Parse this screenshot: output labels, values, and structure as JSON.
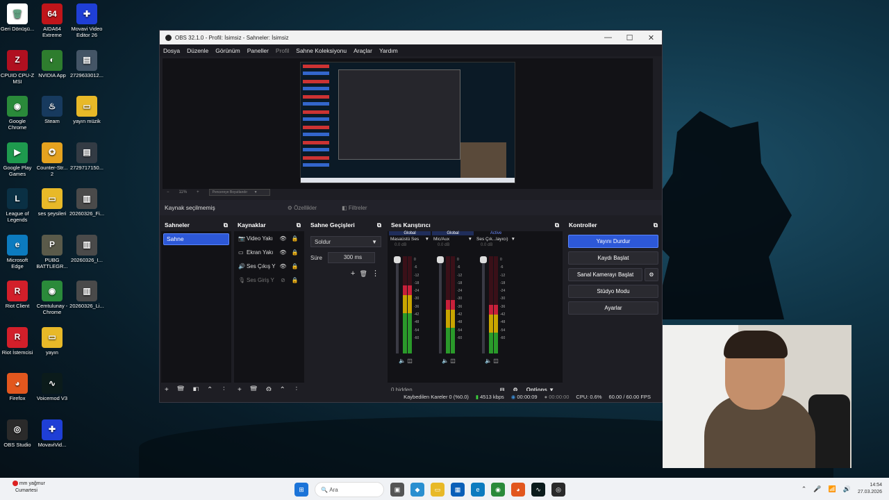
{
  "desktop_icons": [
    {
      "label": "Geri Dönüşü...",
      "color": "#ffffff",
      "glyph": "🗑",
      "x": 0,
      "y": 0
    },
    {
      "label": "AIDA64 Extreme",
      "color": "#c0151a",
      "glyph": "64",
      "x": 1,
      "y": 0
    },
    {
      "label": "Movavi Video Editor 26",
      "color": "#1f3fd6",
      "glyph": "✚",
      "x": 2,
      "y": 0
    },
    {
      "label": "CPUID CPU-Z MSI",
      "color": "#b01020",
      "glyph": "Z",
      "x": 0,
      "y": 1
    },
    {
      "label": "NVIDIA App",
      "color": "#2e7d2e",
      "glyph": "◐",
      "x": 1,
      "y": 1
    },
    {
      "label": "2729633012...",
      "color": "#445566",
      "glyph": "▤",
      "x": 2,
      "y": 1
    },
    {
      "label": "Google Chrome",
      "color": "#2a8a3a",
      "glyph": "◉",
      "x": 0,
      "y": 2
    },
    {
      "label": "Steam",
      "color": "#173a5e",
      "glyph": "♨",
      "x": 1,
      "y": 2
    },
    {
      "label": "yayın müzik",
      "color": "#e8b928",
      "glyph": "▭",
      "x": 2,
      "y": 2
    },
    {
      "label": "Google Play Games",
      "color": "#1e9a4e",
      "glyph": "▶",
      "x": 0,
      "y": 3
    },
    {
      "label": "Counter-Str... 2",
      "color": "#e5a21f",
      "glyph": "✪",
      "x": 1,
      "y": 3
    },
    {
      "label": "2729717150...",
      "color": "#333b44",
      "glyph": "▤",
      "x": 2,
      "y": 3
    },
    {
      "label": "League of Legends",
      "color": "#0a3044",
      "glyph": "L",
      "x": 0,
      "y": 4
    },
    {
      "label": "ses şeysileri",
      "color": "#e8b928",
      "glyph": "▭",
      "x": 1,
      "y": 4
    },
    {
      "label": "20260326_Fi...",
      "color": "#4a4a4a",
      "glyph": "▥",
      "x": 2,
      "y": 4
    },
    {
      "label": "Microsoft Edge",
      "color": "#0c7bbf",
      "glyph": "e",
      "x": 0,
      "y": 5
    },
    {
      "label": "PUBG BATTLEGR...",
      "color": "#5a5a4a",
      "glyph": "P",
      "x": 1,
      "y": 5
    },
    {
      "label": "20260326_I...",
      "color": "#4a4a4a",
      "glyph": "▥",
      "x": 2,
      "y": 5
    },
    {
      "label": "Riot Client",
      "color": "#d21f2a",
      "glyph": "R",
      "x": 0,
      "y": 6
    },
    {
      "label": "Cemtulunay - Chrome",
      "color": "#2a8a3a",
      "glyph": "◉",
      "x": 1,
      "y": 6
    },
    {
      "label": "20260326_Li...",
      "color": "#4a4a4a",
      "glyph": "▥",
      "x": 2,
      "y": 6
    },
    {
      "label": "Riot İstemcisi",
      "color": "#d21f2a",
      "glyph": "R",
      "x": 0,
      "y": 7
    },
    {
      "label": "yayın",
      "color": "#e8b928",
      "glyph": "▭",
      "x": 1,
      "y": 7
    },
    {
      "label": "Firefox",
      "color": "#e2571e",
      "glyph": "◕",
      "x": 0,
      "y": 8
    },
    {
      "label": "Voicemod V3",
      "color": "#0b1b1b",
      "glyph": "∿",
      "x": 1,
      "y": 8
    },
    {
      "label": "OBS Studio",
      "color": "#2a2a2a",
      "glyph": "◎",
      "x": 0,
      "y": 9
    },
    {
      "label": "MovaviVid...",
      "color": "#1f3fd6",
      "glyph": "✚",
      "x": 1,
      "y": 9
    }
  ],
  "obs": {
    "title": "OBS 32.1.0 - Profil: İsimsiz - Sahneler: İsimsiz",
    "window_controls": [
      "—",
      "☐",
      "✕"
    ],
    "menu": [
      "Dosya",
      "Düzenle",
      "Görünüm",
      "Paneller",
      "Profil",
      "Sahne Koleksiyonu",
      "Araçlar",
      "Yardım"
    ],
    "zoom": {
      "minus": "−",
      "value": "11%",
      "plus": "+",
      "select": "Pencereye Boyutlandır"
    },
    "source_bar": {
      "label": "Kaynak seçilmemiş",
      "properties": "Özellikler",
      "filters": "Filtreler"
    },
    "docks": {
      "scenes": {
        "title": "Sahneler",
        "items": [
          "Sahne"
        ]
      },
      "sources": {
        "title": "Kaynaklar",
        "items": [
          {
            "icon": "📷",
            "name": "Video Yakı",
            "dim": false
          },
          {
            "icon": "▭",
            "name": "Ekran Yakı",
            "dim": false
          },
          {
            "icon": "🔊",
            "name": "Ses Çıkış Y",
            "dim": false
          },
          {
            "icon": "🎙",
            "name": "Ses Giriş Y",
            "dim": true
          }
        ]
      },
      "transitions": {
        "title": "Sahne Geçişleri",
        "selected": "Soldur",
        "duration_label": "Süre",
        "duration": "300 ms"
      },
      "mixer": {
        "title": "Ses Karıştırıcı",
        "channels": [
          {
            "tag": "Global",
            "name": "Masaüstü Ses",
            "db": "0.0 dB",
            "level": 0.7
          },
          {
            "tag": "Global",
            "name": "Mic/Aux",
            "db": "0.0 dB",
            "level": 0.55
          },
          {
            "tag": "Active",
            "name": "Ses Çık...layıcı)",
            "db": "0.0 dB",
            "level": 0.5
          }
        ],
        "scale": [
          "0",
          "-6",
          "-12",
          "-18",
          "-24",
          "-30",
          "-36",
          "-42",
          "-48",
          "-54",
          "-60"
        ],
        "hidden": "0 hidden",
        "options": "Options"
      },
      "controls": {
        "title": "Kontroller",
        "buttons": [
          "Yayını Durdur",
          "Kaydı Başlat",
          "Sanal Kamerayı Başlat",
          "Stüdyo Modu",
          "Ayarlar"
        ]
      }
    },
    "status": {
      "dropped": "Kaybedilen Kareler 0 (%0.0)",
      "bitrate": "4513 kbps",
      "stream_time": "00:00:09",
      "rec_time": "00:00:00",
      "cpu": "CPU: 0.6%",
      "fps": "60.00 / 60.00 FPS"
    }
  },
  "taskbar": {
    "weather_line1": "2 mm yağmur",
    "weather_line2": "Cumartesi",
    "search": "Ara",
    "time": "14:54",
    "date": "27.03.2026"
  }
}
